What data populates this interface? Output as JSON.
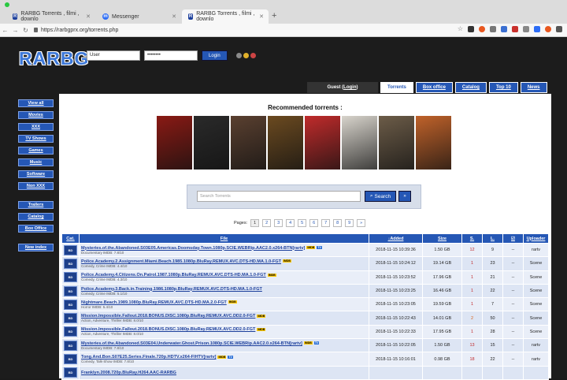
{
  "browser": {
    "tabs": [
      {
        "title": "RARBG Torrents , filmi , downlo",
        "icon": "rarbg-favicon",
        "active": false
      },
      {
        "title": "Messenger",
        "icon": "messenger-icon",
        "active": false
      },
      {
        "title": "RARBG Torrents , filmi , downlo",
        "icon": "rarbg-favicon",
        "active": true
      }
    ],
    "url": "https://rarbgprx.org/torrents.php"
  },
  "header": {
    "logo": "RARBG",
    "username_value": "User",
    "password_value": "••••••••",
    "login_label": "Login"
  },
  "topnav": {
    "guest": "Guest (",
    "guest_login": "Login",
    "guest_close": ")",
    "items": [
      "Torrents",
      "Box office",
      "Catalog",
      "Top 10",
      "News"
    ]
  },
  "sidebar": {
    "group1": [
      "View all",
      "Movies",
      "XXX",
      "TV Shows",
      "Games",
      "Music",
      "Software",
      "Non XXX"
    ],
    "group2": [
      "Trailers",
      "Catalog",
      "Box Office"
    ],
    "group3": [
      "New index"
    ]
  },
  "main": {
    "recommended_title": "Recommended torrents :",
    "posters": [
      "#8a1a14",
      "#2a2a2a",
      "#5a4030",
      "#6b4a20",
      "#c02b2b",
      "#d8d4cc",
      "#6c5c48",
      "#c0622a"
    ],
    "search_placeholder": "Search Torrents",
    "search_label": "Search",
    "search_more": "»",
    "pager_label": "Pages:",
    "pages": [
      "1",
      "2",
      "3",
      "4",
      "5",
      "6",
      "7",
      "8",
      "9",
      "»"
    ]
  },
  "table": {
    "headers": {
      "cat": "Cat.",
      "file": "File",
      "added": "↓Added",
      "size": "Size",
      "s": "S.",
      "l": "L.",
      "c": "☑",
      "uploader": "Uploader"
    },
    "rows": [
      {
        "name": "Mysteries.of.the.Abandoned.S03E05.Americas.Doomsday.Town.1080p.SCIE.WEBRip.AAC2.0.x264-BTN[rartv]",
        "badges": [
          "IMDB",
          "TV"
        ],
        "sub": "Documentary IMDB: 7.8/10",
        "added": "2018-11-15 10:39:36",
        "size": "1.50 GB",
        "s": "12",
        "l": "9",
        "c": "--",
        "uploader": "rartv"
      },
      {
        "name": "Police.Academy.2.Assignment.Miami.Beach.1985.1080p.BluRay.REMUX.AVC.DTS-HD.MA.1.0-FGT",
        "badges": [
          "IMDB"
        ],
        "sub": "Comedy, Crime IMDB: 4.4/10",
        "added": "2018-11-15 10:24:12",
        "size": "19.14 GB",
        "s": "1",
        "l": "23",
        "c": "--",
        "uploader": "Scene"
      },
      {
        "name": "Police.Academy.4.Citizens.On.Patrol.1987.1080p.BluRay.REMUX.AVC.DTS-HD.MA.1.0-FGT",
        "badges": [
          "IMDB"
        ],
        "sub": "Comedy, Crime IMDB: 4.3/10",
        "added": "2018-11-15 10:23:52",
        "size": "17.96 GB",
        "s": "1",
        "l": "21",
        "c": "--",
        "uploader": "Scene"
      },
      {
        "name": "Police.Academy.3.Back.in.Training.1986.1080p.BluRay.REMUX.AVC.DTS-HD.MA.1.0-FGT",
        "badges": [],
        "sub": "Comedy, Crime IMDB: 5.1/10",
        "added": "2018-11-15 10:23:25",
        "size": "16.46 GB",
        "s": "1",
        "l": "22",
        "c": "--",
        "uploader": "Scene"
      },
      {
        "name": "Nightmare.Beach.1989.1080p.BluRay.REMUX.AVC.DTS-HD.MA.2.0-FGT",
        "badges": [
          "IMDB"
        ],
        "sub": "Horror IMDB: 5.4/10",
        "added": "2018-11-15 10:23:05",
        "size": "19.59 GB",
        "s": "1",
        "l": "7",
        "c": "--",
        "uploader": "Scene"
      },
      {
        "name": "Mission.Impossible.Fallout.2018.BONUS.DISC.1080p.BluRay.REMUX.AVC.DD2.0-FGT",
        "badges": [
          "IMDB"
        ],
        "sub": "Action, Adventure, Thriller IMDB: 8.0/10",
        "added": "2018-11-15 10:22:43",
        "size": "14.01 GB",
        "s": "2",
        "l": "50",
        "c": "--",
        "uploader": "Scene"
      },
      {
        "name": "Mission.Impossible.Fallout.2018.BONUS.DISC.1080p.BluRay.REMUX.AVC.DD2.0-FGT",
        "badges": [
          "IMDB"
        ],
        "sub": "Action, Adventure, Thriller IMDB: 8.0/10",
        "added": "2018-11-15 10:22:33",
        "size": "17.95 GB",
        "s": "1",
        "l": "28",
        "c": "--",
        "uploader": "Scene"
      },
      {
        "name": "Mysteries.of.the.Abandoned.S03E04.Underwater.Ghost.Prison.1080p.SCIE.WEBRip.AAC2.0.x264-BTN[rartv]",
        "badges": [
          "IMDB",
          "TV"
        ],
        "sub": "Documentary IMDB: 7.8/10",
        "added": "2018-11-15 10:22:05",
        "size": "1.50 GB",
        "s": "13",
        "l": "15",
        "c": "--",
        "uploader": "rartv"
      },
      {
        "name": "Tong.And.Bon.S07E25.Series.Finale.720p.HDTV.x264-FIHTV[rartv]",
        "badges": [
          "IMDB",
          "TV"
        ],
        "sub": "Comedy, Talk-Show IMDB: 7.8/10",
        "added": "2018-11-15 10:16:01",
        "size": "0.98 GB",
        "s": "18",
        "l": "22",
        "c": "--",
        "uploader": "rartv"
      },
      {
        "name": "Franklyn.2008.720p.BluRay.H264.AAC-RARBG",
        "badges": [],
        "sub": "",
        "added": "",
        "size": "",
        "s": "",
        "l": "",
        "c": "",
        "uploader": ""
      }
    ]
  }
}
